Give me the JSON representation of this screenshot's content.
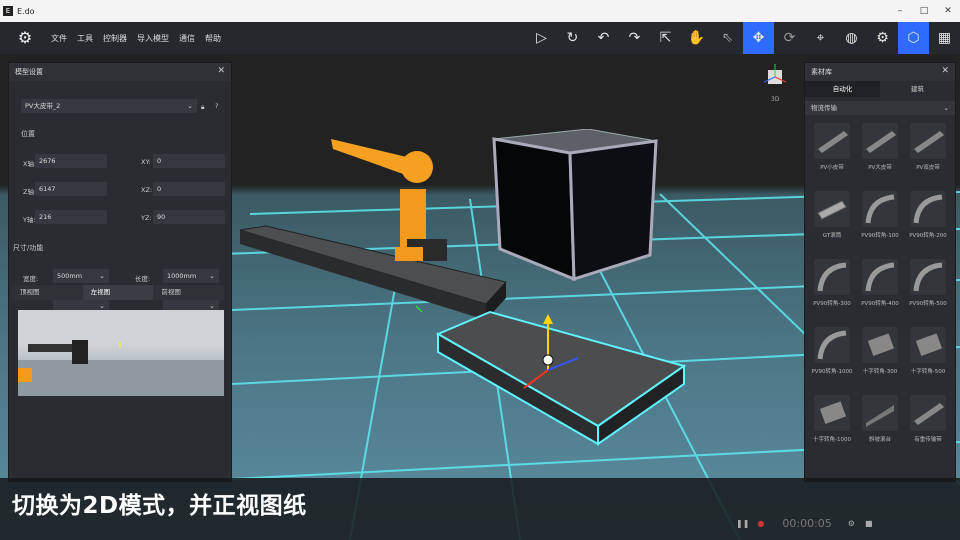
{
  "window": {
    "title": "E.do",
    "min": "–",
    "max": "□",
    "close": "✕"
  },
  "menu": [
    "文件",
    "工具",
    "控制器",
    "导入模型",
    "通信",
    "帮助"
  ],
  "toolbar": [
    {
      "name": "play-icon",
      "glyph": "▷"
    },
    {
      "name": "reset-icon",
      "glyph": "↻"
    },
    {
      "name": "undo-icon",
      "glyph": "↶"
    },
    {
      "name": "redo-icon",
      "glyph": "↷"
    },
    {
      "name": "select-cursor-icon",
      "glyph": "⇱"
    },
    {
      "name": "robot-hand-icon",
      "glyph": "✋"
    },
    {
      "name": "pointer-icon",
      "glyph": "⇖"
    },
    {
      "name": "move-icon",
      "glyph": "✥"
    },
    {
      "name": "rotate-icon",
      "glyph": "⟳"
    },
    {
      "name": "target-icon",
      "glyph": "⌖"
    },
    {
      "name": "globe-icon",
      "glyph": "◍"
    },
    {
      "name": "gear-icon",
      "glyph": "⚙"
    },
    {
      "name": "cube-icon",
      "glyph": "⬡"
    },
    {
      "name": "grid-apps-icon",
      "glyph": "▦"
    }
  ],
  "left_panel": {
    "title": "模型设置",
    "model_select": "PV大皮带_2",
    "position_title": "位置",
    "fields": {
      "x_label": "X轴:",
      "x_value": "2676",
      "z_label": "Z轴:",
      "z_value": "6147",
      "y_label": "Y轴:",
      "y_value": "216",
      "xy_label": "XY:",
      "xy_value": "0",
      "xz_label": "XZ:",
      "xz_value": "0",
      "yz_label": "YZ:",
      "yz_value": "90"
    },
    "size_title": "尺寸/功能",
    "width_label": "宽度:",
    "width_value": "500mm",
    "length_label": "长度:",
    "length_value": "1000mm",
    "view_tabs": [
      "顶视图",
      "左视图",
      "前视图"
    ],
    "view_tab_active": 1
  },
  "view_cube_label": "3D",
  "right_panel": {
    "title": "素材库",
    "tabs": [
      "自动化",
      "建筑"
    ],
    "tab_active": 0,
    "category": "物流传输",
    "items": [
      "PV小皮带",
      "PV大皮带",
      "PV双皮带",
      "GT滚筒",
      "PV90转角-100",
      "PV90转角-200",
      "PV90转角-300",
      "PV90转角-400",
      "PV90转角-500",
      "PV90转角-1000",
      "十字转角-300",
      "十字转角-500",
      "十字转角-1000",
      "斜坡滚台",
      "有重传输带"
    ]
  },
  "player": {
    "time": "00:00:05"
  },
  "caption": "切换为2D模式，并正视图纸"
}
